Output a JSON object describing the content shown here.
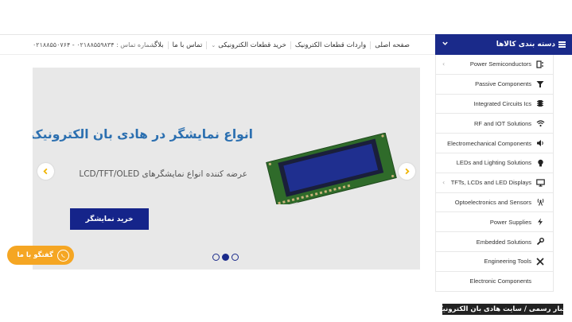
{
  "nav": {
    "items": [
      {
        "label": "صفحه اصلی",
        "has_caret": false
      },
      {
        "label": "واردات قطعات الکترونیک",
        "has_caret": false
      },
      {
        "label": "خرید قطعات الکترونیکی",
        "has_caret": true
      },
      {
        "label": "تماس با ما",
        "has_caret": false
      },
      {
        "label": "بلاگ",
        "has_caret": false
      }
    ],
    "phone_label": "شماره تماس :",
    "phone_numbers": "۰۲۱۸۸۵۵۹۸۳۴ - ۰۲۱۸۸۵۵۰۷۶۴"
  },
  "categories": {
    "title": "دسته بندی کالاها",
    "items": [
      {
        "label": "Power Semiconductors",
        "icon": "power-semiconductor-icon",
        "has_sub": true
      },
      {
        "label": "Passive Components",
        "icon": "funnel-icon",
        "has_sub": false
      },
      {
        "label": "Integrated Circuits Ics",
        "icon": "chip-icon",
        "has_sub": false
      },
      {
        "label": "RF and IOT Solutions",
        "icon": "wifi-icon",
        "has_sub": false
      },
      {
        "label": "Electromechanical Components",
        "icon": "speaker-icon",
        "has_sub": false
      },
      {
        "label": "LEDs and Lighting Solutions",
        "icon": "bulb-icon",
        "has_sub": false
      },
      {
        "label": "TFTs, LCDs and LED Displays",
        "icon": "monitor-icon",
        "has_sub": true
      },
      {
        "label": "Optoelectronics and Sensors",
        "icon": "antenna-icon",
        "has_sub": false
      },
      {
        "label": "Power Supplies",
        "icon": "bolt-icon",
        "has_sub": false
      },
      {
        "label": "Embedded Solutions",
        "icon": "wrench-icon",
        "has_sub": false
      },
      {
        "label": "Engineering Tools",
        "icon": "tools-icon",
        "has_sub": false
      },
      {
        "label": "Electronic Components",
        "icon": "",
        "has_sub": false
      }
    ]
  },
  "slider": {
    "title": "انواع نمایشگر در هادی بان الکترونیک",
    "subtitle": "عرضه کننده انواع نمایشگرهای LCD/TFT/OLED",
    "button_label": "خرید نمایشگر",
    "slide_count": 3,
    "active_index": 1
  },
  "chat": {
    "label": "گفتگو با ما"
  },
  "caption": {
    "text": "اخبار رسمی / سایت هادی بان الکترونیک"
  },
  "colors": {
    "brand_blue": "#1a2a8a",
    "title_blue": "#2b6fb0",
    "chat_orange": "#f5a623"
  }
}
